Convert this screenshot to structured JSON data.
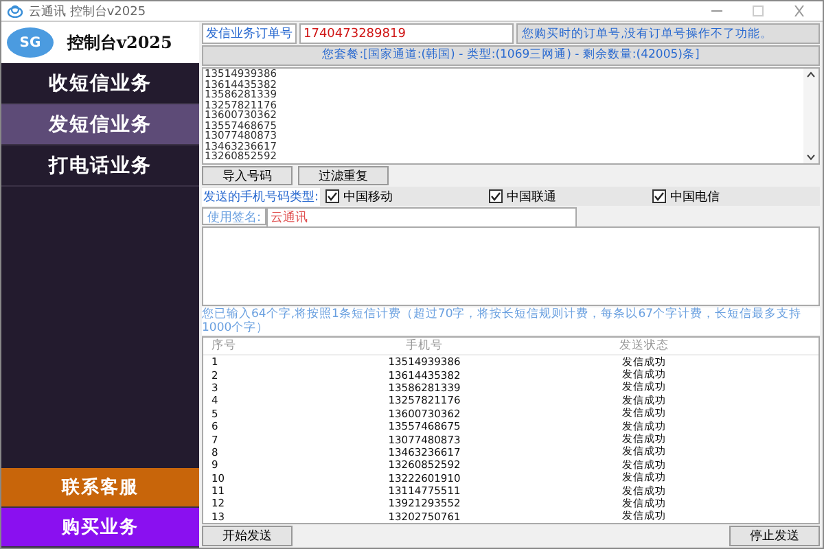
{
  "window": {
    "title": "云通讯 控制台v2025"
  },
  "sidebar": {
    "logo_badge": "SG",
    "logo_text": "控制台v2025",
    "items": [
      {
        "label": "收短信业务",
        "selected": false
      },
      {
        "label": "发短信业务",
        "selected": true
      },
      {
        "label": "打电话业务",
        "selected": false
      }
    ],
    "bottom_items": [
      {
        "label": "联系客服",
        "color": "#c8650a"
      },
      {
        "label": "购买业务",
        "color": "#8a10f0"
      }
    ]
  },
  "order": {
    "label": "发信业务订单号",
    "value": "1740473289819",
    "note": "您购买时的订单号,没有订单号操作不了功能。"
  },
  "package": "您套餐:[国家通道:(韩国) - 类型:(1069三网通) - 剩余数量:(42005)条]",
  "numbers": [
    "13514939386",
    "13614435382",
    "13586281339",
    "13257821176",
    "13600730362",
    "13557468675",
    "13077480873",
    "13463236617",
    "13260852592"
  ],
  "number_buttons": [
    "导入号码",
    "过滤重复"
  ],
  "carriers": {
    "label": "发送的手机号码类型:",
    "items": [
      {
        "label": "中国移动",
        "checked": true
      },
      {
        "label": "中国联通",
        "checked": true
      },
      {
        "label": "中国电信",
        "checked": true
      }
    ]
  },
  "signature": {
    "label": "使用签名:",
    "value": "云通讯"
  },
  "counter": "您已输入64个字,将按照1条短信计费（超过70字，将按长短信规则计费，每条以67个字计费，长短信最多支持1000个字）",
  "table": {
    "columns": [
      "序号",
      "手机号",
      "发送状态"
    ],
    "rows": [
      [
        "1",
        "13514939386",
        "发信成功"
      ],
      [
        "2",
        "13614435382",
        "发信成功"
      ],
      [
        "3",
        "13586281339",
        "发信成功"
      ],
      [
        "4",
        "13257821176",
        "发信成功"
      ],
      [
        "5",
        "13600730362",
        "发信成功"
      ],
      [
        "6",
        "13557468675",
        "发信成功"
      ],
      [
        "7",
        "13077480873",
        "发信成功"
      ],
      [
        "8",
        "13463236617",
        "发信成功"
      ],
      [
        "9",
        "13260852592",
        "发信成功"
      ],
      [
        "10",
        "13222601910",
        "发信成功"
      ],
      [
        "11",
        "13114775511",
        "发信成功"
      ],
      [
        "12",
        "13921293552",
        "发信成功"
      ],
      [
        "13",
        "13202750761",
        "发信成功"
      ]
    ]
  },
  "buttons": {
    "start": "开始发送",
    "stop": "停止发送"
  }
}
